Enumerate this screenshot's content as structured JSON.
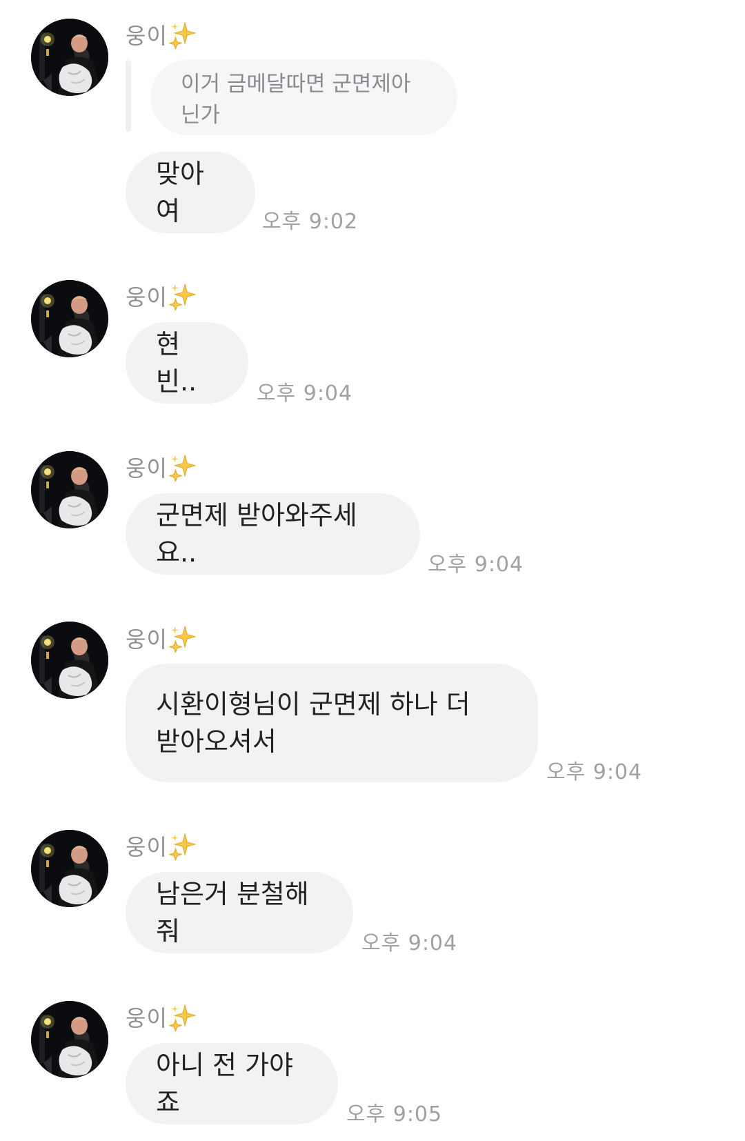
{
  "messages": [
    {
      "sender": "웅이",
      "reply_text": "이거 금메달따면 군면제아닌가",
      "text": "맞아여",
      "time": "오후 9:02"
    },
    {
      "sender": "웅이",
      "text": "현빈..",
      "time": "오후 9:04"
    },
    {
      "sender": "웅이",
      "text": "군면제 받아와주세요..",
      "time": "오후 9:04"
    },
    {
      "sender": "웅이",
      "text": "시환이형님이 군면제 하나 더\n받아오셔서",
      "time": "오후 9:04"
    },
    {
      "sender": "웅이",
      "text": "남은거 분철해줘",
      "time": "오후 9:04"
    },
    {
      "sender": "웅이",
      "text": "아니 전 가야죠",
      "time": "오후 9:05"
    }
  ],
  "icons": {
    "sender_suffix": "sparkles-icon",
    "avatar": "profile-photo"
  },
  "colors": {
    "bubble": "#f2f2f4",
    "sender_text": "#8e8e93",
    "time_text": "#a0a0a5"
  }
}
